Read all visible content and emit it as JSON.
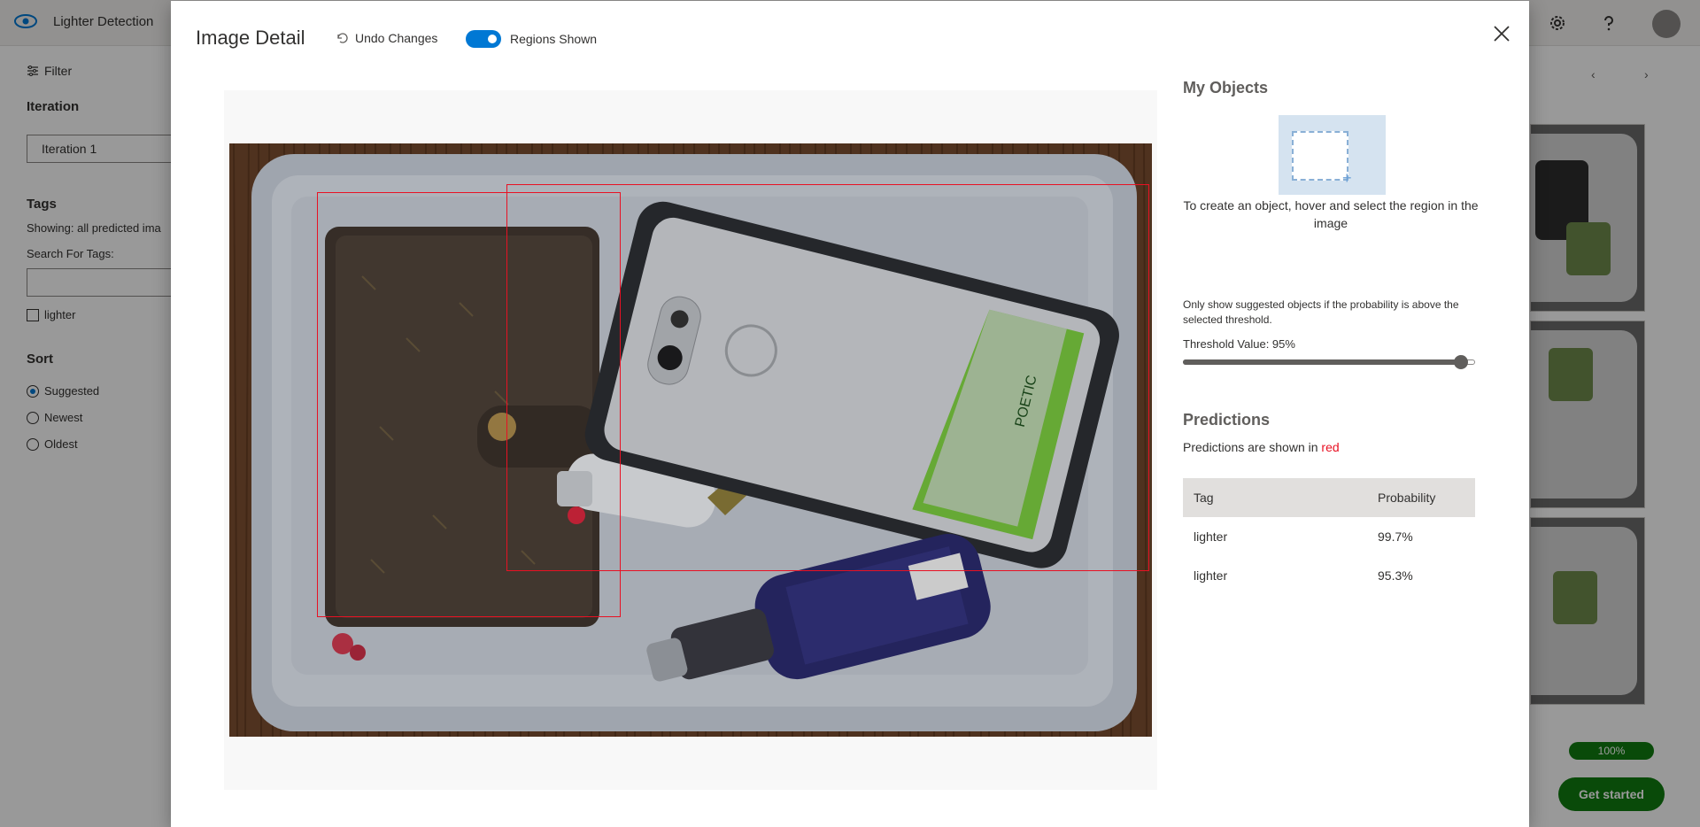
{
  "app": {
    "project_name": "Lighter Detection",
    "filter_label": "Filter",
    "iteration_heading": "Iteration",
    "iteration_value": "Iteration 1",
    "tags_heading": "Tags",
    "showing_text": "Showing: all predicted ima",
    "search_tags_label": "Search For Tags:",
    "tag_checkbox_label": "lighter",
    "sort_heading": "Sort",
    "sort_options": [
      "Suggested",
      "Newest",
      "Oldest"
    ],
    "prev_arrow": "‹",
    "next_arrow": "›",
    "progress_badge": "100%",
    "get_started_label": "Get started"
  },
  "modal": {
    "title": "Image Detail",
    "undo_label": "Undo Changes",
    "regions_label": "Regions Shown",
    "regions_shown": true
  },
  "objects": {
    "heading": "My Objects",
    "hint": "To create an object, hover and select the region in the image"
  },
  "threshold": {
    "description": "Only show suggested objects if the probability is above the selected threshold.",
    "value_label": "Threshold Value: 95%",
    "value": 0.95
  },
  "predictions": {
    "heading": "Predictions",
    "note_prefix": "Predictions are shown in ",
    "note_color_word": "red",
    "columns": [
      "Tag",
      "Probability"
    ],
    "rows": [
      {
        "tag": "lighter",
        "probability": "99.7%"
      },
      {
        "tag": "lighter",
        "probability": "95.3%"
      }
    ]
  },
  "colors": {
    "accent": "#0078d4",
    "prediction_box": "#e81123",
    "success": "#107c10"
  }
}
